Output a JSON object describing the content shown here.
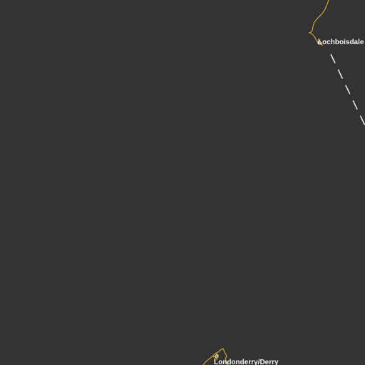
{
  "map": {
    "background_color": "#333333",
    "coastline_color": "#e8b830",
    "ferry_route_color": "#f0f0f0",
    "label_color": "#f2f2f2",
    "places": [
      {
        "id": "lochboisdale",
        "name": "Lochboisdale"
      },
      {
        "id": "londonderry",
        "name": "Londonderry/Derry"
      }
    ]
  }
}
